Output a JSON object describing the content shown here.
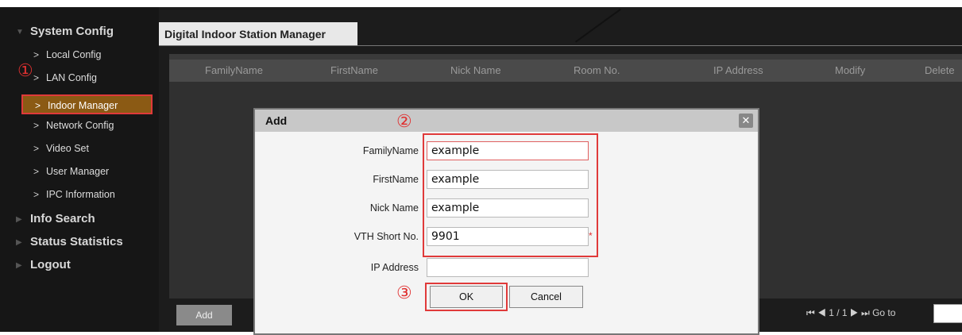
{
  "sidebar": {
    "system_config": "System Config",
    "items": [
      {
        "label": "Local Config"
      },
      {
        "label": "LAN Config"
      },
      {
        "label": "Indoor Manager"
      },
      {
        "label": "Network Config"
      },
      {
        "label": "Video Set"
      },
      {
        "label": "User Manager"
      },
      {
        "label": "IPC Information"
      }
    ],
    "info_search": "Info Search",
    "status_statistics": "Status Statistics",
    "logout": "Logout"
  },
  "annotations": {
    "one": "①",
    "two": "②",
    "three": "③"
  },
  "tab": {
    "title": "Digital Indoor Station Manager"
  },
  "table": {
    "columns": [
      "FamilyName",
      "FirstName",
      "Nick Name",
      "Room No.",
      "IP Address",
      "Modify",
      "Delete"
    ]
  },
  "add_button": "Add",
  "pager": {
    "arrows_first": "⏮",
    "text": "◀ 1 / 1 ▶",
    "goto": "Go to"
  },
  "dialog": {
    "title": "Add",
    "close": "✕",
    "fields": [
      {
        "label": "FamilyName",
        "value": "example"
      },
      {
        "label": "FirstName",
        "value": "example"
      },
      {
        "label": "Nick Name",
        "value": "example"
      },
      {
        "label": "VTH Short No.",
        "value": "9901",
        "required_mark": "*"
      },
      {
        "label": "IP Address",
        "value": ""
      }
    ],
    "ok": "OK",
    "cancel": "Cancel"
  }
}
